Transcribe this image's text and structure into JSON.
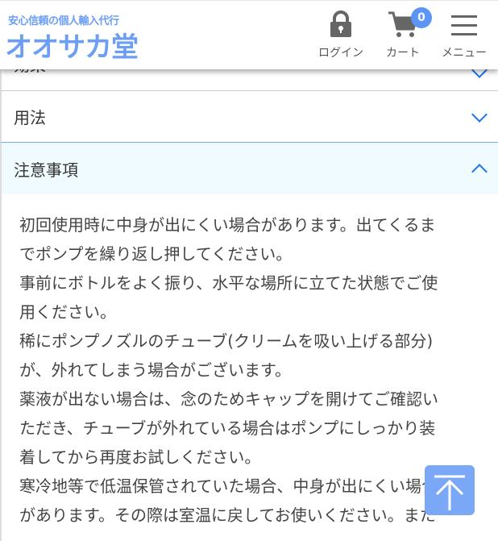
{
  "header": {
    "tagline": "安心信頼の個人輸入代行",
    "logo": "オオサカ堂",
    "login": "ログイン",
    "cart": "カート",
    "cart_count": "0",
    "menu": "メニュー"
  },
  "accordion": [
    {
      "label": "効果",
      "expanded": false
    },
    {
      "label": "用法",
      "expanded": false
    },
    {
      "label": "注意事項",
      "expanded": true
    }
  ],
  "content_lines": [
    "初回使用時に中身が出にくい場合があります。出てくるま",
    "でポンプを繰り返し押してください。",
    "事前にボトルをよく振り、水平な場所に立てた状態でご使",
    "用ください。",
    "稀にポンプノズルのチューブ(クリームを吸い上げる部分)",
    "が、外れてしまう場合がございます。",
    "薬液が出ない場合は、念のためキャップを開けてご確認い",
    "ただき、チューブが外れている場合はポンプにしっかり装",
    "着してから再度お試しください。",
    "寒冷地等で低温保管されていた場合、中身が出にくい場合",
    "があります。その際は室温に戻してお使いください。また"
  ],
  "colors": {
    "brand": "#6c9ef5",
    "accent": "#1a73e8",
    "expanded_bg": "#f0fbff"
  }
}
